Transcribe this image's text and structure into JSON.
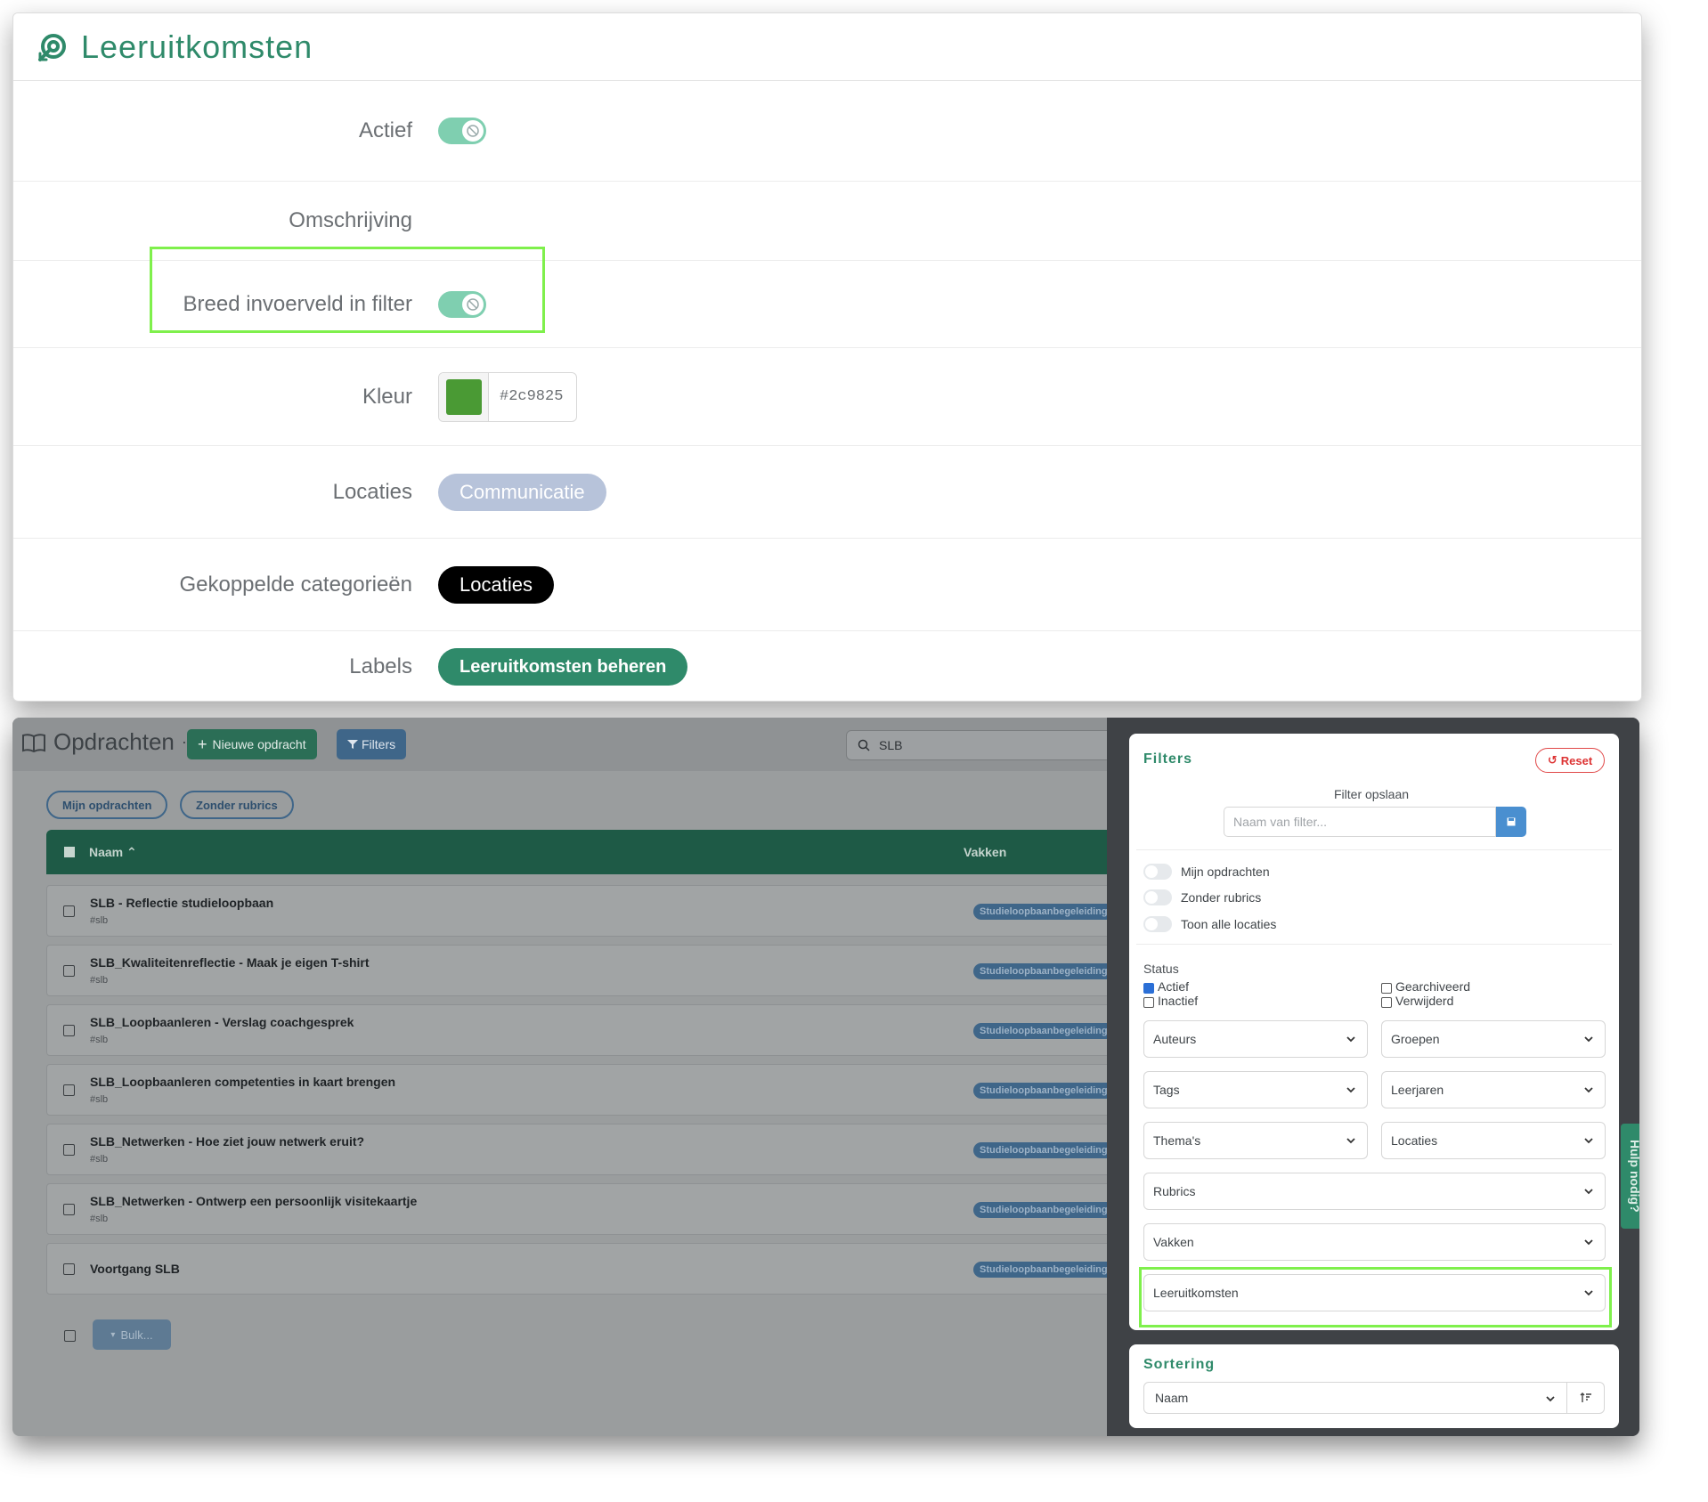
{
  "top": {
    "title": "Leeruitkomsten",
    "rows": {
      "actief": {
        "label": "Actief"
      },
      "omschrijving": {
        "label": "Omschrijving"
      },
      "breed": {
        "label": "Breed invoerveld in filter"
      },
      "kleur": {
        "label": "Kleur",
        "value": "#2c9825"
      },
      "locaties": {
        "label": "Locaties",
        "value": "Communicatie"
      },
      "gekoppeld": {
        "label": "Gekoppelde categorieën",
        "value": "Locaties"
      },
      "labels": {
        "label": "Labels",
        "value": "Leeruitkomsten beheren"
      }
    }
  },
  "bottom": {
    "title": "Opdrachten",
    "new_button": "Nieuwe opdracht",
    "filters_button": "Filters",
    "search_value": "SLB",
    "chips": [
      "Mijn opdrachten",
      "Zonder rubrics"
    ],
    "table": {
      "col_name": "Naam",
      "col_vakken": "Vakken",
      "rows": [
        {
          "name": "SLB - Reflectie studieloopbaan",
          "tag": "#slb",
          "vak": "Studieloopbaanbegeleiding"
        },
        {
          "name": "SLB_Kwaliteitenreflectie - Maak je eigen T-shirt",
          "tag": "#slb",
          "vak": "Studieloopbaanbegeleiding"
        },
        {
          "name": "SLB_Loopbaanleren - Verslag coachgesprek",
          "tag": "#slb",
          "vak": "Studieloopbaanbegeleiding"
        },
        {
          "name": "SLB_Loopbaanleren competenties in kaart brengen",
          "tag": "#slb",
          "vak": "Studieloopbaanbegeleiding"
        },
        {
          "name": "SLB_Netwerken - Hoe ziet jouw netwerk eruit?",
          "tag": "#slb",
          "vak": "Studieloopbaanbegeleiding"
        },
        {
          "name": "SLB_Netwerken - Ontwerp een persoonlijk visitekaartje",
          "tag": "#slb",
          "vak": "Studieloopbaanbegeleiding"
        },
        {
          "name": "Voortgang SLB",
          "tag": "",
          "vak": "Studieloopbaanbegeleiding"
        }
      ]
    },
    "bulk_button": "Bulk...",
    "help_tab": "Hulp nodig?"
  },
  "filters": {
    "title": "Filters",
    "reset": "Reset",
    "save_label": "Filter opslaan",
    "save_placeholder": "Naam van filter...",
    "toggles": [
      "Mijn opdrachten",
      "Zonder rubrics",
      "Toon alle locaties"
    ],
    "status_label": "Status",
    "status": {
      "actief": "Actief",
      "inactief": "Inactief",
      "gearchiveerd": "Gearchiveerd",
      "verwijderd": "Verwijderd"
    },
    "selects": {
      "auteurs": "Auteurs",
      "groepen": "Groepen",
      "tags": "Tags",
      "leerjaren": "Leerjaren",
      "themas": "Thema's",
      "locaties": "Locaties",
      "rubrics": "Rubrics",
      "vakken": "Vakken",
      "leeruitkomsten": "Leeruitkomsten"
    }
  },
  "sorting": {
    "title": "Sortering",
    "value": "Naam"
  }
}
